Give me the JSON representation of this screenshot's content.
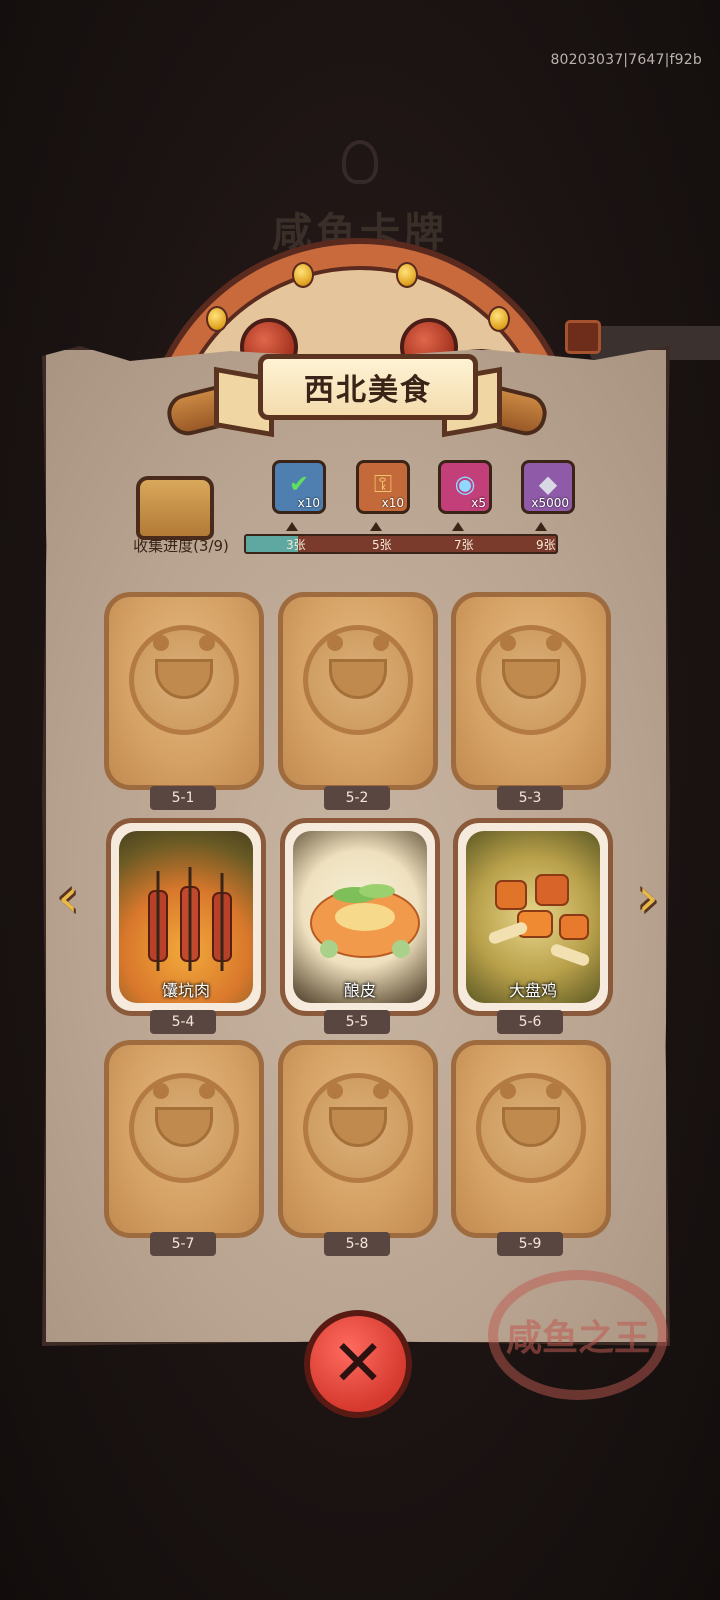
{
  "build_id": "80203037|7647|f92b",
  "background": {
    "title": "咸鱼卡牌"
  },
  "header": {
    "title": "西北美食"
  },
  "collection": {
    "label": "收集进度(3/9)",
    "collected": 3,
    "total": 9,
    "progress_fraction": 0.1667,
    "milestones": [
      {
        "label": "3张",
        "icon": "chest-check-icon",
        "quantity": "x10",
        "color": "#4f7fb0"
      },
      {
        "label": "5张",
        "icon": "scroll-key-icon",
        "quantity": "x10",
        "color": "#c46a3a"
      },
      {
        "label": "7张",
        "icon": "swirl-orb-icon",
        "quantity": "x5",
        "color": "#c23f7a"
      },
      {
        "label": "9张",
        "icon": "crystal-icon",
        "quantity": "x5000",
        "color": "#8f5ba8"
      }
    ]
  },
  "cards": [
    {
      "id": "5-1",
      "name": "",
      "unlocked": false
    },
    {
      "id": "5-2",
      "name": "",
      "unlocked": false
    },
    {
      "id": "5-3",
      "name": "",
      "unlocked": false
    },
    {
      "id": "5-4",
      "name": "馕坑肉",
      "unlocked": true
    },
    {
      "id": "5-5",
      "name": "酿皮",
      "unlocked": true
    },
    {
      "id": "5-6",
      "name": "大盘鸡",
      "unlocked": true
    },
    {
      "id": "5-7",
      "name": "",
      "unlocked": false
    },
    {
      "id": "5-8",
      "name": "",
      "unlocked": false
    },
    {
      "id": "5-9",
      "name": "",
      "unlocked": false
    }
  ],
  "stamp": {
    "text": "咸鱼之王"
  },
  "icons": {
    "prev": "chevron-left-icon",
    "next": "chevron-right-icon",
    "close": "close-icon"
  }
}
